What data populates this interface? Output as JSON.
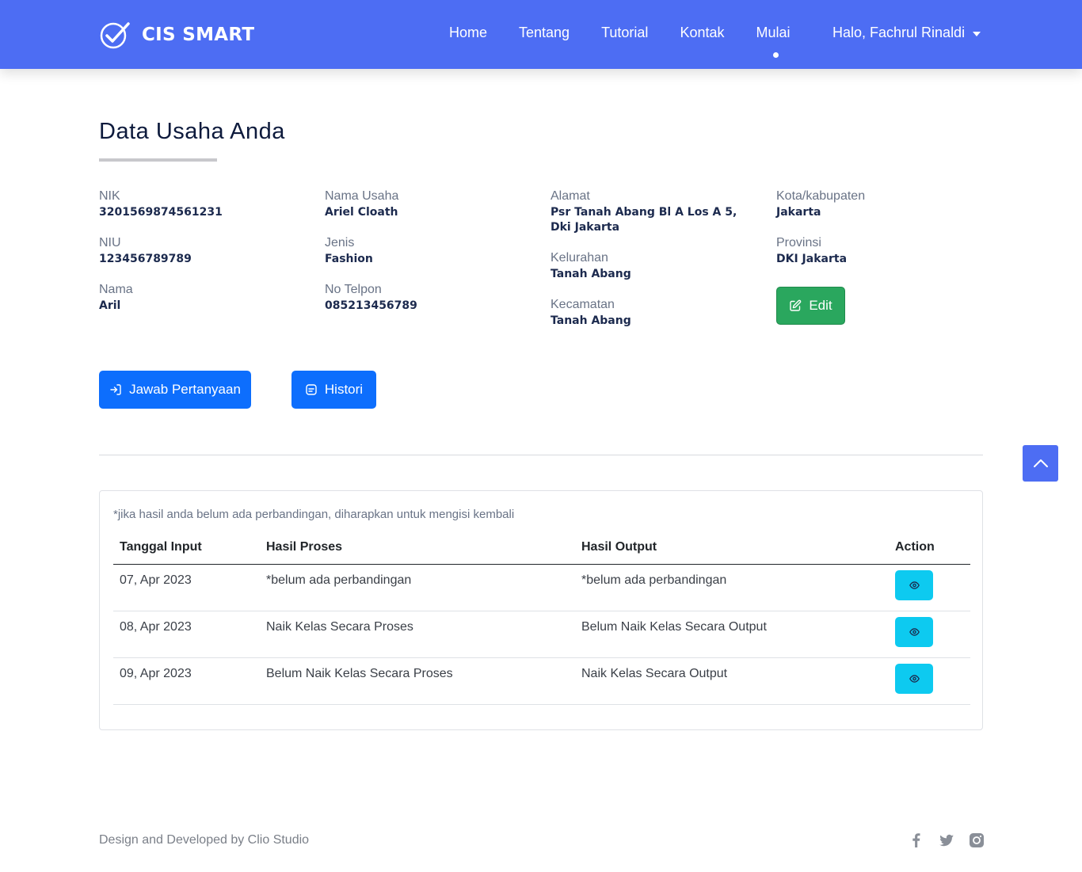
{
  "navbar": {
    "brand": "CIS SMART",
    "links": [
      "Home",
      "Tentang",
      "Tutorial",
      "Kontak",
      "Mulai"
    ],
    "active_link": "Mulai",
    "user_greeting": "Halo, Fachrul Rinaldi"
  },
  "page": {
    "title": "Data Usaha Anda"
  },
  "profile": {
    "nik_label": "NIK",
    "nik_value": "3201569874561231",
    "niu_label": "NIU",
    "niu_value": "123456789789",
    "nama_label": "Nama",
    "nama_value": "Aril",
    "nama_usaha_label": "Nama Usaha",
    "nama_usaha_value": "Ariel Cloath",
    "jenis_label": "Jenis",
    "jenis_value": "Fashion",
    "telpon_label": "No Telpon",
    "telpon_value": "085213456789",
    "alamat_label": "Alamat",
    "alamat_value": "Psr Tanah Abang Bl A Los A 5, Dki Jakarta",
    "kelurahan_label": "Kelurahan",
    "kelurahan_value": "Tanah Abang",
    "kecamatan_label": "Kecamatan",
    "kecamatan_value": "Tanah Abang",
    "kota_label": "Kota/kabupaten",
    "kota_value": "Jakarta",
    "provinsi_label": "Provinsi",
    "provinsi_value": "DKI Jakarta"
  },
  "buttons": {
    "edit": "Edit",
    "jawab": "Jawab Pertanyaan",
    "histori": "Histori"
  },
  "history": {
    "note": "*jika hasil anda belum ada perbandingan, diharapkan untuk mengisi kembali",
    "columns": [
      "Tanggal Input",
      "Hasil Proses",
      "Hasil Output",
      "Action"
    ],
    "rows": [
      {
        "tanggal": "07, Apr 2023",
        "proses": "*belum ada perbandingan",
        "output": "*belum ada perbandingan"
      },
      {
        "tanggal": "08, Apr 2023",
        "proses": "Naik Kelas Secara Proses",
        "output": "Belum Naik Kelas Secara Output"
      },
      {
        "tanggal": "09, Apr 2023",
        "proses": "Belum Naik Kelas Secara Proses",
        "output": "Naik Kelas Secara Output"
      }
    ]
  },
  "footer": {
    "credit": "Design and Developed by Clio Studio",
    "socials": [
      "facebook-icon",
      "twitter-icon",
      "instagram-icon"
    ]
  },
  "colors": {
    "nav_bg": "#4d6df3",
    "primary": "#0d6efd",
    "success": "#2aa75e",
    "info": "#0dcaf0"
  }
}
